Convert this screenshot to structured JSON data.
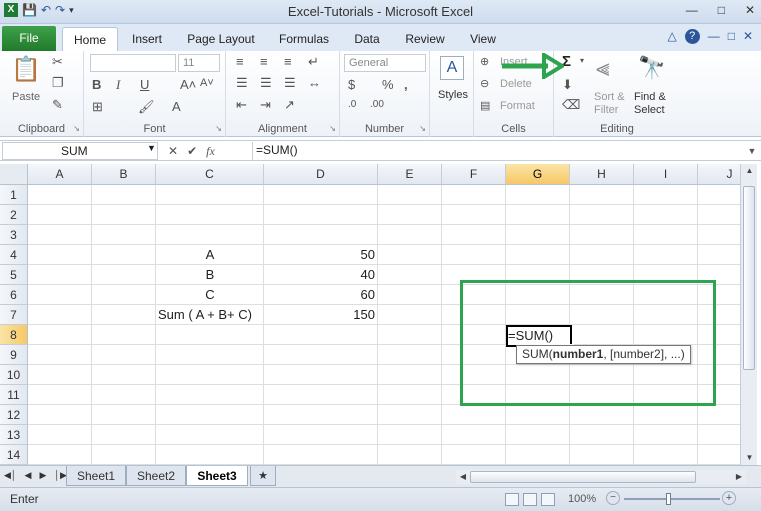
{
  "window": {
    "title": "Excel-Tutorials  -  Microsoft Excel"
  },
  "tabs": {
    "file": "File",
    "items": [
      "Home",
      "Insert",
      "Page Layout",
      "Formulas",
      "Data",
      "Review",
      "View"
    ]
  },
  "ribbon": {
    "clipboard": {
      "paste": "Paste",
      "label": "Clipboard"
    },
    "font": {
      "name_value": "",
      "size_value": "11",
      "label": "Font"
    },
    "alignment": {
      "label": "Alignment"
    },
    "number": {
      "format_value": "General",
      "label": "Number"
    },
    "styles": {
      "label": "Styles"
    },
    "cells": {
      "insert": "Insert",
      "delete": "Delete",
      "format": "Format",
      "label": "Cells"
    },
    "editing": {
      "sort_filter_1": "Sort &",
      "sort_filter_2": "Filter",
      "find_select_1": "Find &",
      "find_select_2": "Select",
      "label": "Editing"
    }
  },
  "formula_bar": {
    "name_box": "SUM",
    "formula": "=SUM()"
  },
  "columns": [
    "A",
    "B",
    "C",
    "D",
    "E",
    "F",
    "G",
    "H",
    "I",
    "J"
  ],
  "rows": [
    "1",
    "2",
    "3",
    "4",
    "5",
    "6",
    "7",
    "8",
    "9",
    "10",
    "11",
    "12",
    "13",
    "14"
  ],
  "cells": {
    "c4": "A",
    "d4": "50",
    "c5": "B",
    "d5": "40",
    "c6": "C",
    "d6": "60",
    "c7": "Sum ( A + B+ C)",
    "d7": "150",
    "g8": "=SUM()"
  },
  "tooltip": {
    "fn": "SUM(",
    "arg1": "number1",
    "rest": ", [number2], ...)"
  },
  "sheets": [
    "Sheet1",
    "Sheet2",
    "Sheet3"
  ],
  "status": {
    "mode": "Enter",
    "zoom": "100%"
  },
  "colors": {
    "annotation_green": "#2ea44f",
    "file_tab": "#217a2c"
  }
}
